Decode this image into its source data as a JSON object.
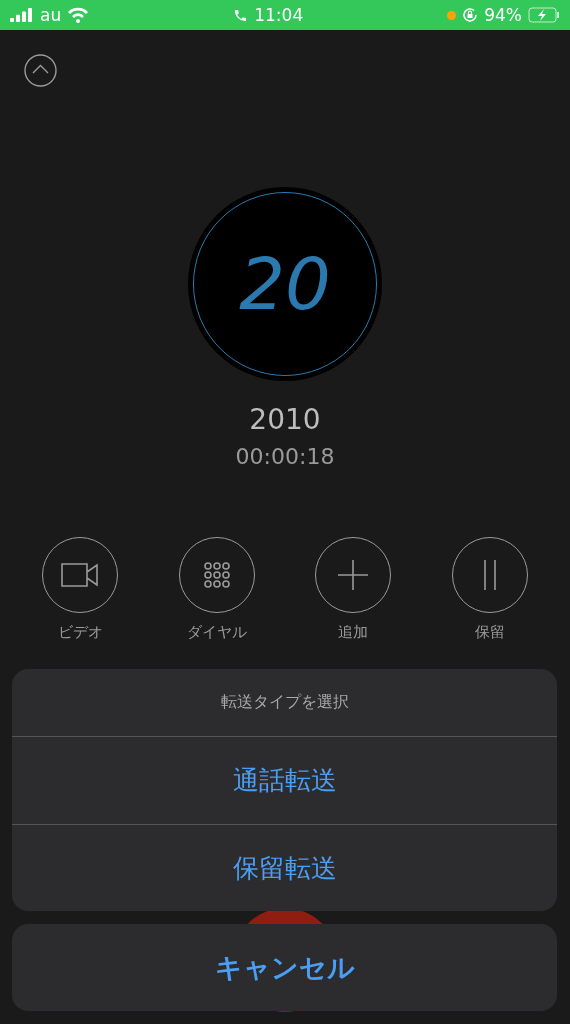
{
  "status_bar": {
    "carrier": "au",
    "time": "11:04",
    "battery": "94%",
    "charging": true
  },
  "contact": {
    "avatar_text": "20",
    "name": "2010",
    "duration": "00:00:18"
  },
  "controls": [
    {
      "kind": "video",
      "label": "ビデオ"
    },
    {
      "kind": "keypad",
      "label": "ダイヤル"
    },
    {
      "kind": "add",
      "label": "追加"
    },
    {
      "kind": "hold",
      "label": "保留"
    }
  ],
  "action_sheet": {
    "title": "転送タイプを選択",
    "options": [
      "通話転送",
      "保留転送"
    ],
    "cancel": "キャンセル"
  }
}
